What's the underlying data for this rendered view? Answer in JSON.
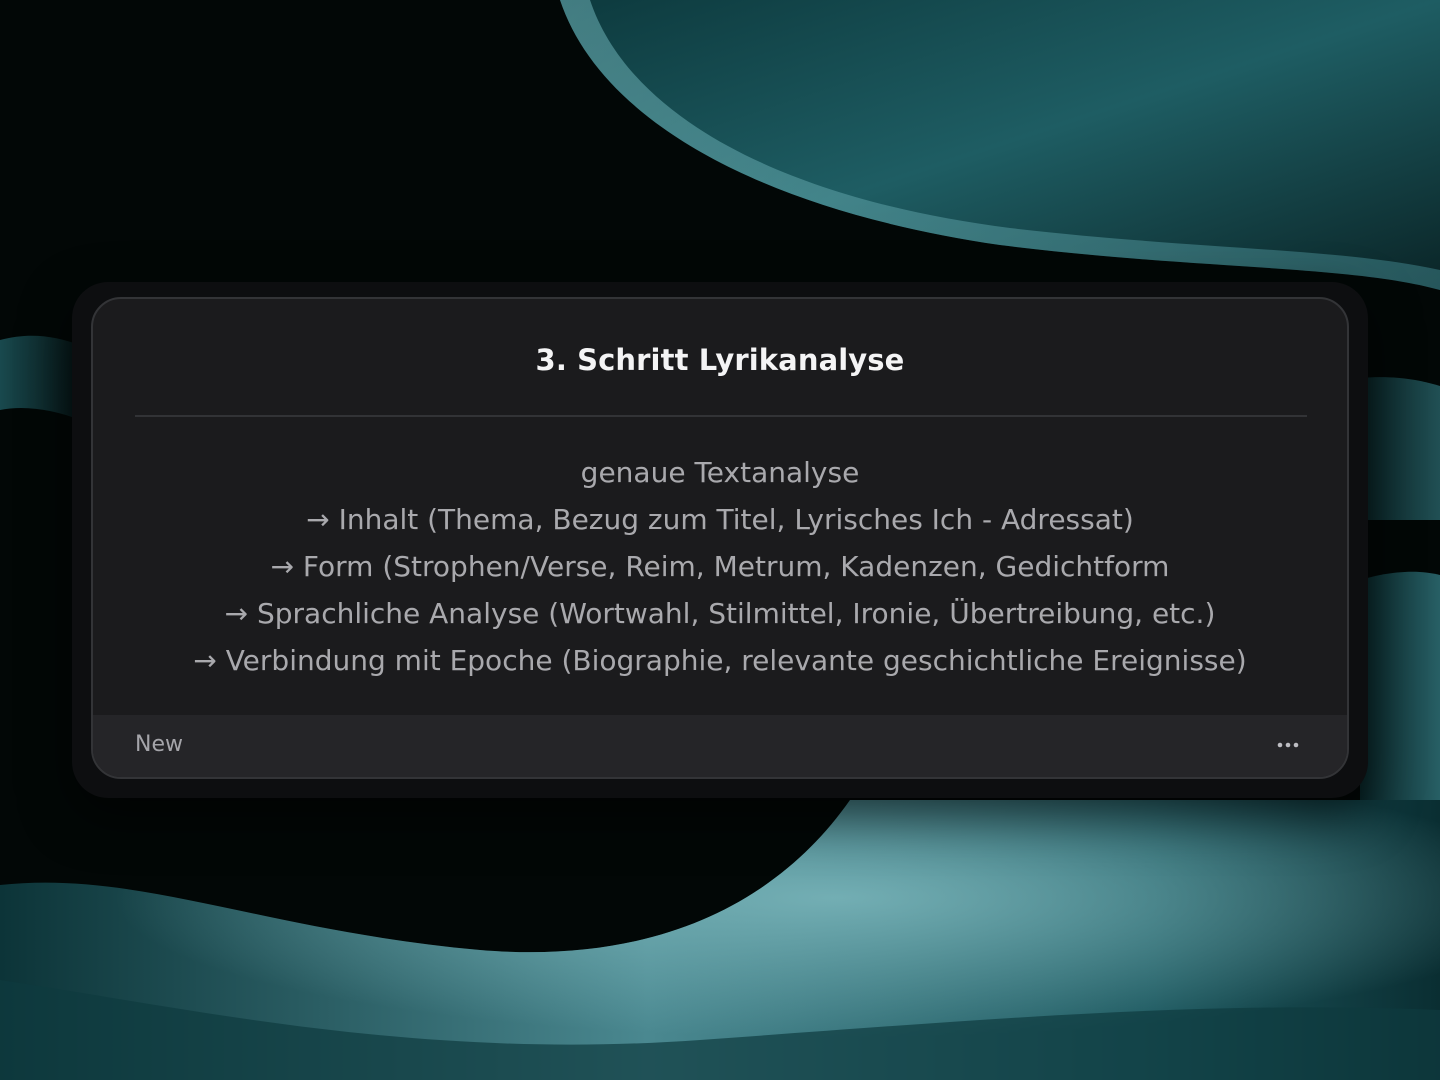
{
  "card": {
    "title": "3. Schritt Lyrikanalyse",
    "lines": [
      "genaue Textanalyse",
      "→ Inhalt (Thema, Bezug zum Titel, Lyrisches Ich - Adressat)",
      "→ Form (Strophen/Verse, Reim, Metrum, Kadenzen, Gedichtform",
      "→ Sprachliche Analyse (Wortwahl, Stilmittel, Ironie, Übertreibung, etc.)",
      "→ Verbindung mit Epoche (Biographie, relevante geschichtliche Ereignisse)"
    ],
    "footer_label": "New",
    "more_icon": "more-horizontal-icon"
  },
  "colors": {
    "background": "#020706",
    "wave_accent": "#4f8f96",
    "card_bg": "#1b1b1d",
    "footer_bg": "#252528",
    "title_text": "#f4f4f5",
    "body_text": "#a9a9ad"
  }
}
